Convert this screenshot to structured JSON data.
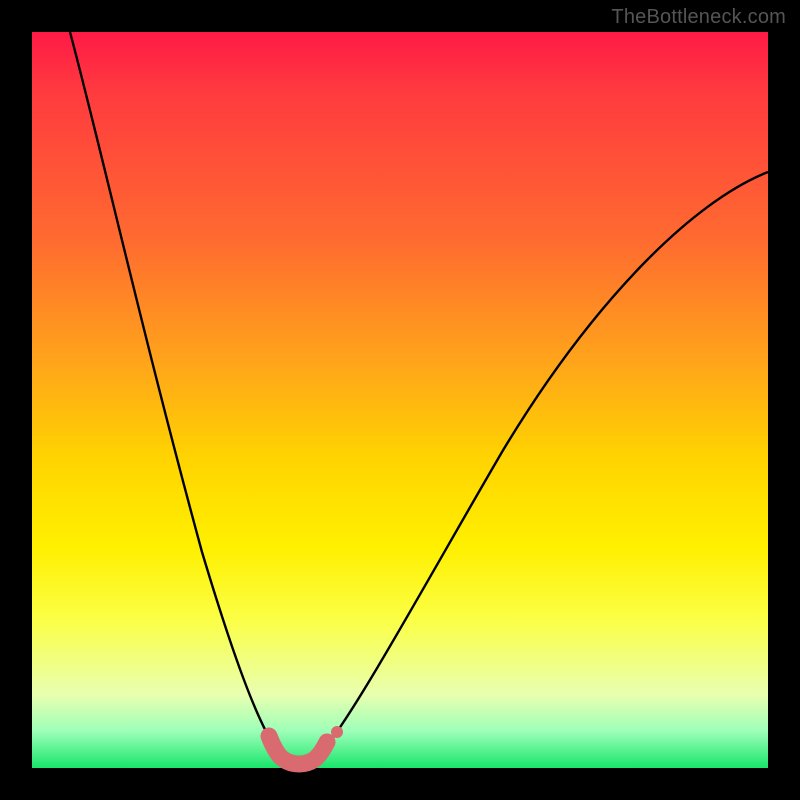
{
  "watermark": {
    "text": "TheBottleneck.com"
  },
  "colors": {
    "page_bg": "#000000",
    "curve_stroke": "#000000",
    "marker_fill": "#d96a6f",
    "marker_stroke": "#d96a6f"
  },
  "chart_data": {
    "type": "line",
    "title": "",
    "xlabel": "",
    "ylabel": "",
    "xlim": [
      0,
      100
    ],
    "ylim": [
      0,
      100
    ],
    "grid": false,
    "series": [
      {
        "name": "bottleneck-curve",
        "x": [
          3,
          6,
          9,
          12,
          15,
          18,
          21,
          24,
          27,
          30,
          32,
          33,
          34,
          35,
          36,
          37,
          38,
          39,
          41,
          44,
          50,
          56,
          62,
          70,
          78,
          86,
          94,
          100
        ],
        "y": [
          100,
          90,
          79,
          68,
          56,
          45,
          34,
          24,
          15,
          8,
          4,
          2.5,
          1.6,
          1.1,
          1.0,
          1.1,
          1.6,
          2.5,
          5,
          10,
          22,
          34,
          45,
          58,
          68,
          75,
          80,
          82
        ]
      }
    ],
    "markers": {
      "name": "valley-markers",
      "x_range": [
        32.5,
        38.5
      ],
      "y_approx": 1.2,
      "count_thick": 8,
      "outlier": {
        "x": 40.5,
        "y": 3.0
      }
    }
  }
}
